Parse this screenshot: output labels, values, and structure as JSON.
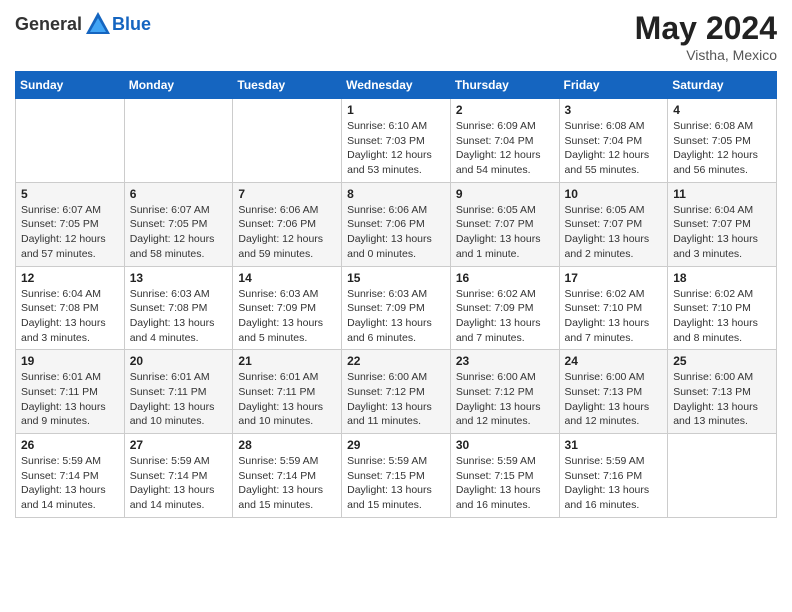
{
  "logo": {
    "general": "General",
    "blue": "Blue"
  },
  "header": {
    "month_year": "May 2024",
    "location": "Vistha, Mexico"
  },
  "weekdays": [
    "Sunday",
    "Monday",
    "Tuesday",
    "Wednesday",
    "Thursday",
    "Friday",
    "Saturday"
  ],
  "weeks": [
    [
      {
        "day": "",
        "sunrise": "",
        "sunset": "",
        "daylight": ""
      },
      {
        "day": "",
        "sunrise": "",
        "sunset": "",
        "daylight": ""
      },
      {
        "day": "",
        "sunrise": "",
        "sunset": "",
        "daylight": ""
      },
      {
        "day": "1",
        "sunrise": "Sunrise: 6:10 AM",
        "sunset": "Sunset: 7:03 PM",
        "daylight": "Daylight: 12 hours and 53 minutes."
      },
      {
        "day": "2",
        "sunrise": "Sunrise: 6:09 AM",
        "sunset": "Sunset: 7:04 PM",
        "daylight": "Daylight: 12 hours and 54 minutes."
      },
      {
        "day": "3",
        "sunrise": "Sunrise: 6:08 AM",
        "sunset": "Sunset: 7:04 PM",
        "daylight": "Daylight: 12 hours and 55 minutes."
      },
      {
        "day": "4",
        "sunrise": "Sunrise: 6:08 AM",
        "sunset": "Sunset: 7:05 PM",
        "daylight": "Daylight: 12 hours and 56 minutes."
      }
    ],
    [
      {
        "day": "5",
        "sunrise": "Sunrise: 6:07 AM",
        "sunset": "Sunset: 7:05 PM",
        "daylight": "Daylight: 12 hours and 57 minutes."
      },
      {
        "day": "6",
        "sunrise": "Sunrise: 6:07 AM",
        "sunset": "Sunset: 7:05 PM",
        "daylight": "Daylight: 12 hours and 58 minutes."
      },
      {
        "day": "7",
        "sunrise": "Sunrise: 6:06 AM",
        "sunset": "Sunset: 7:06 PM",
        "daylight": "Daylight: 12 hours and 59 minutes."
      },
      {
        "day": "8",
        "sunrise": "Sunrise: 6:06 AM",
        "sunset": "Sunset: 7:06 PM",
        "daylight": "Daylight: 13 hours and 0 minutes."
      },
      {
        "day": "9",
        "sunrise": "Sunrise: 6:05 AM",
        "sunset": "Sunset: 7:07 PM",
        "daylight": "Daylight: 13 hours and 1 minute."
      },
      {
        "day": "10",
        "sunrise": "Sunrise: 6:05 AM",
        "sunset": "Sunset: 7:07 PM",
        "daylight": "Daylight: 13 hours and 2 minutes."
      },
      {
        "day": "11",
        "sunrise": "Sunrise: 6:04 AM",
        "sunset": "Sunset: 7:07 PM",
        "daylight": "Daylight: 13 hours and 3 minutes."
      }
    ],
    [
      {
        "day": "12",
        "sunrise": "Sunrise: 6:04 AM",
        "sunset": "Sunset: 7:08 PM",
        "daylight": "Daylight: 13 hours and 3 minutes."
      },
      {
        "day": "13",
        "sunrise": "Sunrise: 6:03 AM",
        "sunset": "Sunset: 7:08 PM",
        "daylight": "Daylight: 13 hours and 4 minutes."
      },
      {
        "day": "14",
        "sunrise": "Sunrise: 6:03 AM",
        "sunset": "Sunset: 7:09 PM",
        "daylight": "Daylight: 13 hours and 5 minutes."
      },
      {
        "day": "15",
        "sunrise": "Sunrise: 6:03 AM",
        "sunset": "Sunset: 7:09 PM",
        "daylight": "Daylight: 13 hours and 6 minutes."
      },
      {
        "day": "16",
        "sunrise": "Sunrise: 6:02 AM",
        "sunset": "Sunset: 7:09 PM",
        "daylight": "Daylight: 13 hours and 7 minutes."
      },
      {
        "day": "17",
        "sunrise": "Sunrise: 6:02 AM",
        "sunset": "Sunset: 7:10 PM",
        "daylight": "Daylight: 13 hours and 7 minutes."
      },
      {
        "day": "18",
        "sunrise": "Sunrise: 6:02 AM",
        "sunset": "Sunset: 7:10 PM",
        "daylight": "Daylight: 13 hours and 8 minutes."
      }
    ],
    [
      {
        "day": "19",
        "sunrise": "Sunrise: 6:01 AM",
        "sunset": "Sunset: 7:11 PM",
        "daylight": "Daylight: 13 hours and 9 minutes."
      },
      {
        "day": "20",
        "sunrise": "Sunrise: 6:01 AM",
        "sunset": "Sunset: 7:11 PM",
        "daylight": "Daylight: 13 hours and 10 minutes."
      },
      {
        "day": "21",
        "sunrise": "Sunrise: 6:01 AM",
        "sunset": "Sunset: 7:11 PM",
        "daylight": "Daylight: 13 hours and 10 minutes."
      },
      {
        "day": "22",
        "sunrise": "Sunrise: 6:00 AM",
        "sunset": "Sunset: 7:12 PM",
        "daylight": "Daylight: 13 hours and 11 minutes."
      },
      {
        "day": "23",
        "sunrise": "Sunrise: 6:00 AM",
        "sunset": "Sunset: 7:12 PM",
        "daylight": "Daylight: 13 hours and 12 minutes."
      },
      {
        "day": "24",
        "sunrise": "Sunrise: 6:00 AM",
        "sunset": "Sunset: 7:13 PM",
        "daylight": "Daylight: 13 hours and 12 minutes."
      },
      {
        "day": "25",
        "sunrise": "Sunrise: 6:00 AM",
        "sunset": "Sunset: 7:13 PM",
        "daylight": "Daylight: 13 hours and 13 minutes."
      }
    ],
    [
      {
        "day": "26",
        "sunrise": "Sunrise: 5:59 AM",
        "sunset": "Sunset: 7:14 PM",
        "daylight": "Daylight: 13 hours and 14 minutes."
      },
      {
        "day": "27",
        "sunrise": "Sunrise: 5:59 AM",
        "sunset": "Sunset: 7:14 PM",
        "daylight": "Daylight: 13 hours and 14 minutes."
      },
      {
        "day": "28",
        "sunrise": "Sunrise: 5:59 AM",
        "sunset": "Sunset: 7:14 PM",
        "daylight": "Daylight: 13 hours and 15 minutes."
      },
      {
        "day": "29",
        "sunrise": "Sunrise: 5:59 AM",
        "sunset": "Sunset: 7:15 PM",
        "daylight": "Daylight: 13 hours and 15 minutes."
      },
      {
        "day": "30",
        "sunrise": "Sunrise: 5:59 AM",
        "sunset": "Sunset: 7:15 PM",
        "daylight": "Daylight: 13 hours and 16 minutes."
      },
      {
        "day": "31",
        "sunrise": "Sunrise: 5:59 AM",
        "sunset": "Sunset: 7:16 PM",
        "daylight": "Daylight: 13 hours and 16 minutes."
      },
      {
        "day": "",
        "sunrise": "",
        "sunset": "",
        "daylight": ""
      }
    ]
  ]
}
